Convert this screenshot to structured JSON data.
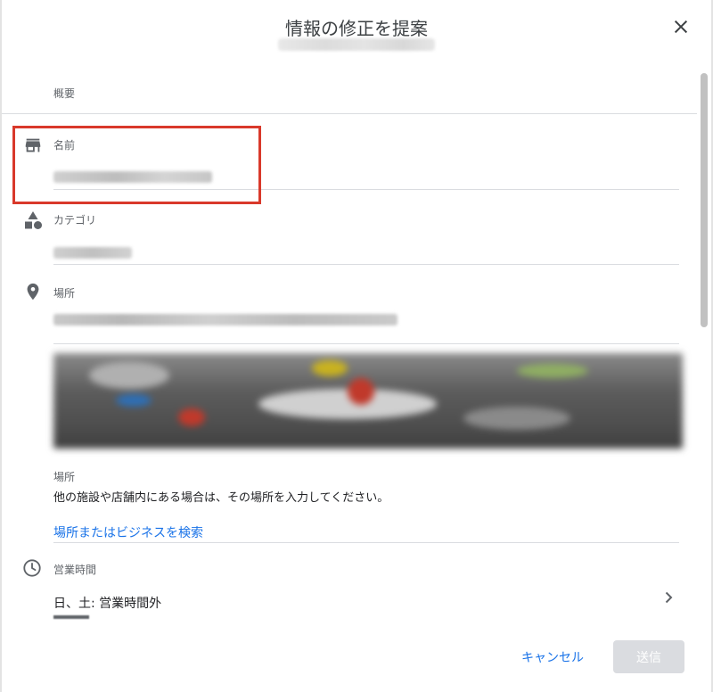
{
  "dialog": {
    "title": "情報の修正を提案",
    "close_icon": "close-icon"
  },
  "sections": {
    "overview_label": "概要",
    "name": {
      "label": "名前",
      "icon": "storefront-icon"
    },
    "category": {
      "label": "カテゴリ",
      "icon": "category-shapes-icon"
    },
    "location": {
      "label": "場所",
      "icon": "location-pin-icon"
    },
    "indoor_location": {
      "label": "場所",
      "description": "他の施設や店舗内にある場合は、その場所を入力してください。",
      "search_link": "場所またはビジネスを検索"
    },
    "hours": {
      "label": "営業時間",
      "icon": "clock-icon",
      "value": "日、土: 営業時間外"
    }
  },
  "footer": {
    "cancel_label": "キャンセル",
    "submit_label": "送信"
  },
  "colors": {
    "accent": "#1a73e8",
    "highlight": "#d9392b",
    "disabled_button": "#dadce0"
  }
}
